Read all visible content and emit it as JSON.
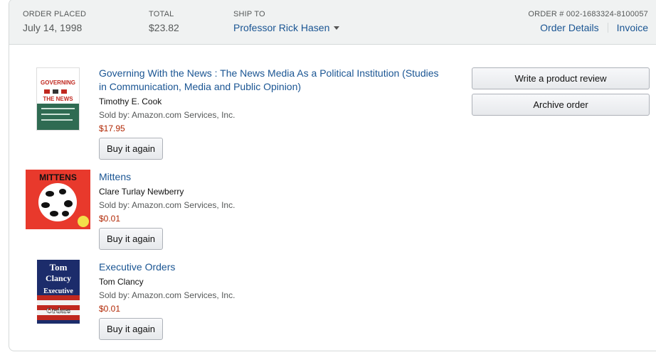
{
  "header": {
    "order_placed_label": "ORDER PLACED",
    "order_placed_value": "July 14, 1998",
    "total_label": "TOTAL",
    "total_value": "$23.82",
    "ship_to_label": "SHIP TO",
    "ship_to_value": "Professor Rick Hasen",
    "order_number_label": "ORDER # 002-1683324-8100057",
    "order_details_link": "Order Details",
    "invoice_link": "Invoice"
  },
  "actions": {
    "write_review": "Write a product review",
    "archive_order": "Archive order"
  },
  "items": [
    {
      "title": "Governing With the News : The News Media As a Political Institution (Studies in Communication, Media and Public Opinion)",
      "author": "Timothy E. Cook",
      "seller": "Sold by: Amazon.com Services, Inc.",
      "price": "$17.95",
      "button": "Buy it again",
      "cover_text": [
        "GOVERNING",
        "THE NEWS"
      ]
    },
    {
      "title": "Mittens",
      "author": "Clare Turlay Newberry",
      "seller": "Sold by: Amazon.com Services, Inc.",
      "price": "$0.01",
      "button": "Buy it again",
      "cover_text": [
        "MITTENS"
      ]
    },
    {
      "title": "Executive Orders",
      "author": "Tom Clancy",
      "seller": "Sold by: Amazon.com Services, Inc.",
      "price": "$0.01",
      "button": "Buy it again",
      "cover_text": [
        "Tom",
        "Clancy",
        "Executive",
        "Orders"
      ]
    }
  ],
  "colors": {
    "link": "#1a5593",
    "price": "#b12704",
    "header_bg": "#f0f2f2"
  }
}
